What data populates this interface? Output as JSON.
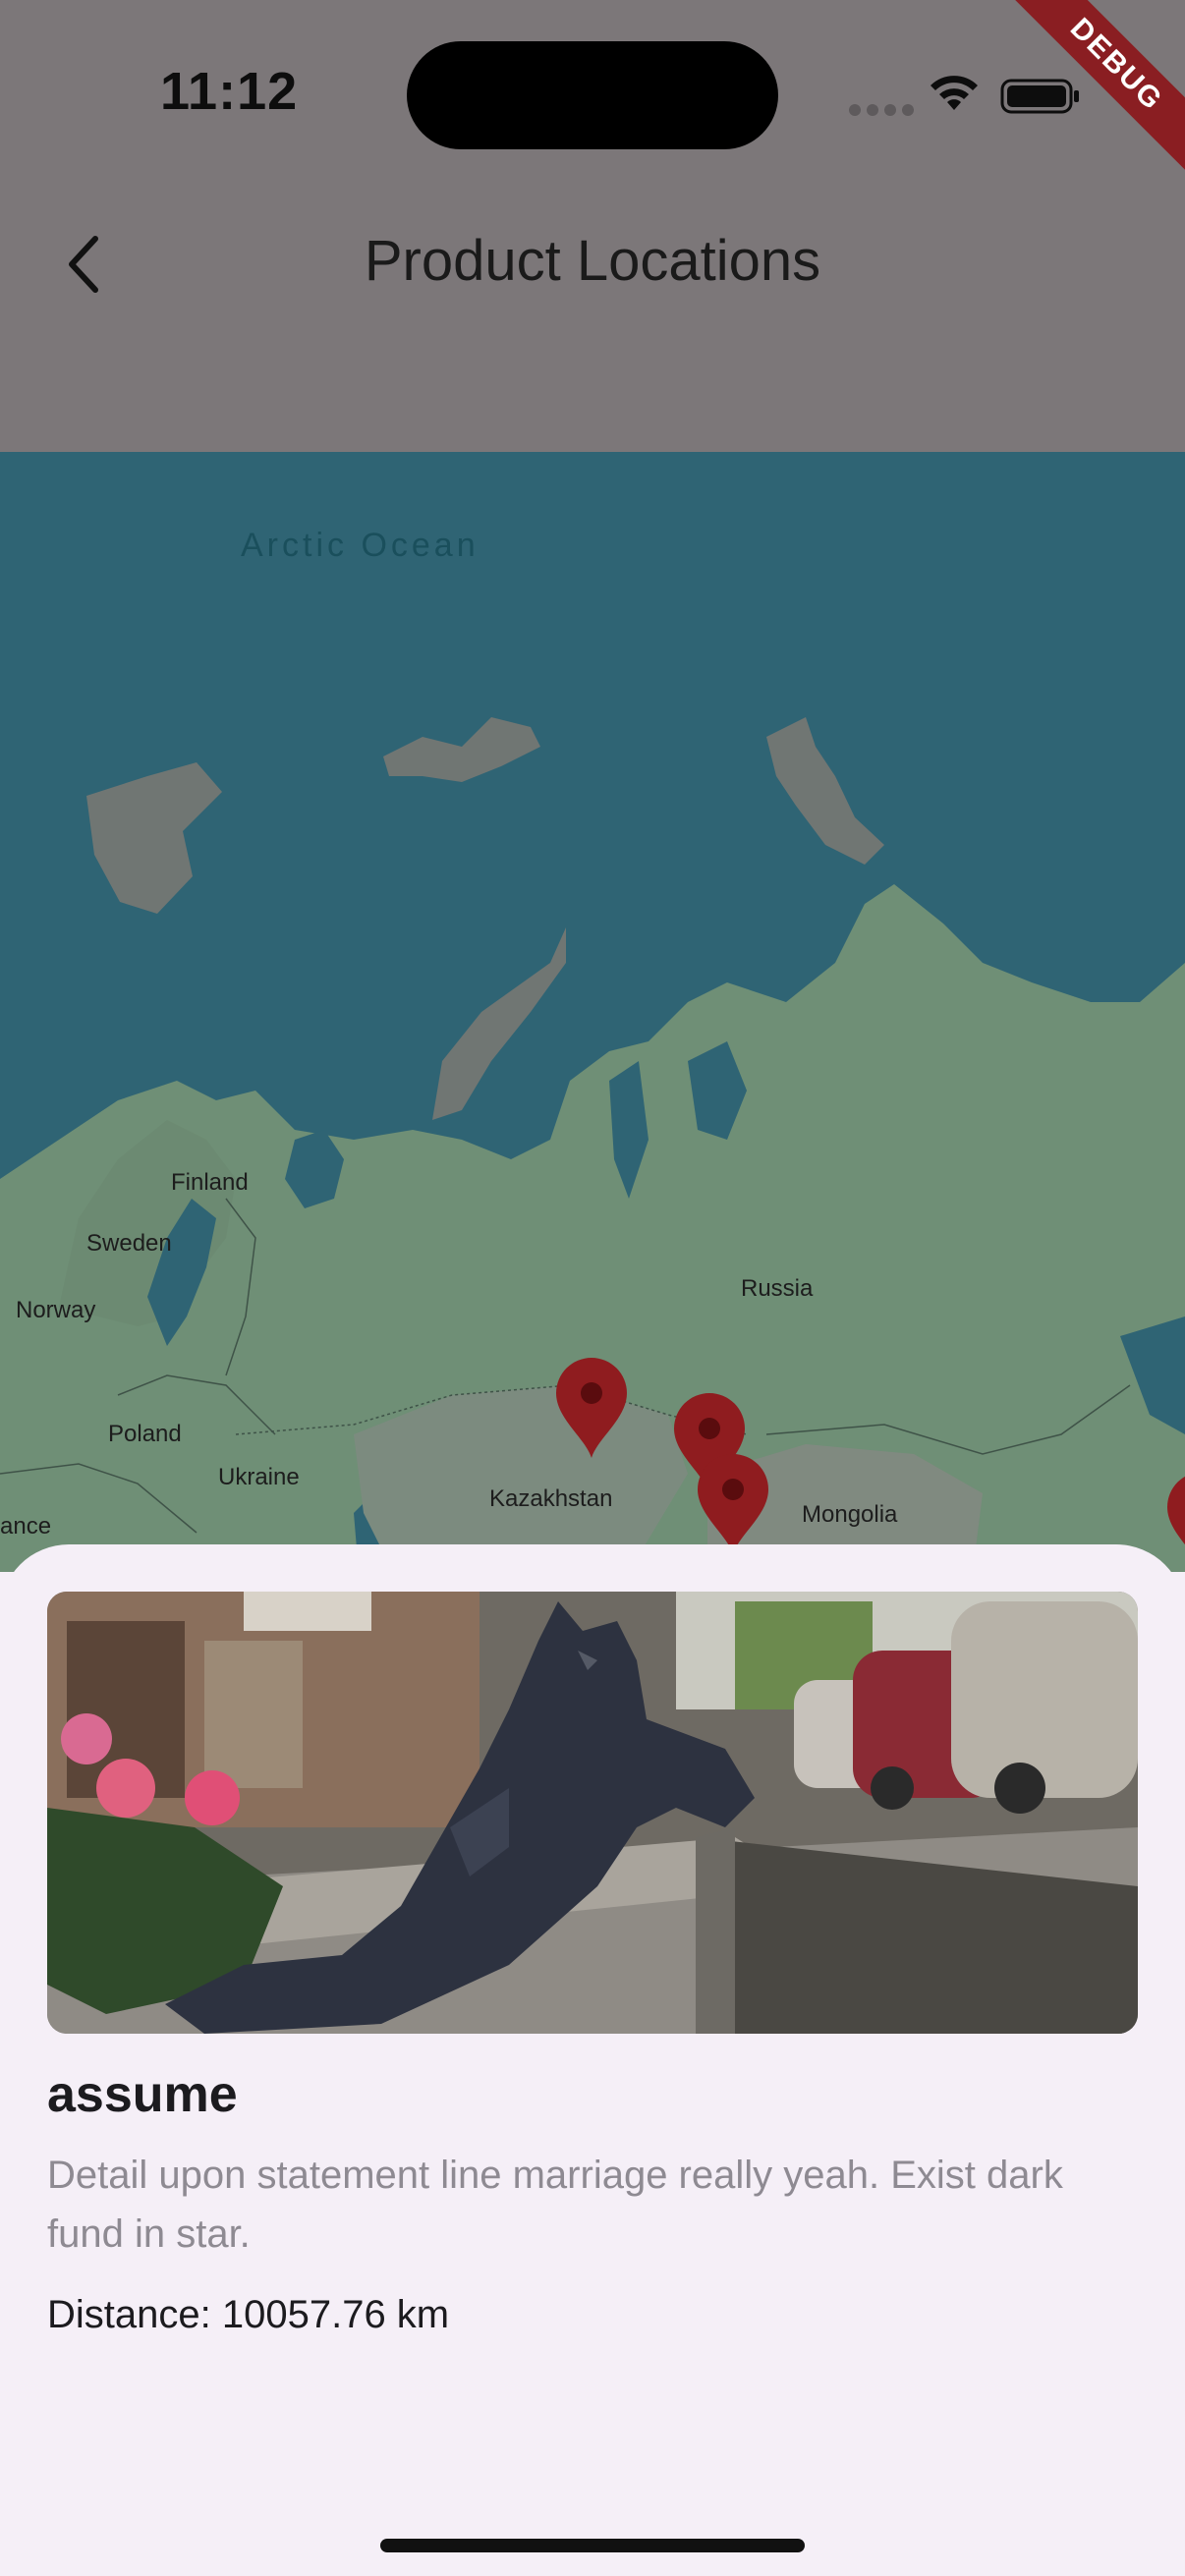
{
  "status_bar": {
    "time": "11:12",
    "debug_banner": "DEBUG"
  },
  "app_bar": {
    "title": "Product Locations",
    "back_icon": "chevron-left-icon"
  },
  "map": {
    "ocean_label": "Arctic Ocean",
    "place_labels": {
      "finland": "Finland",
      "sweden": "Sweden",
      "norway": "Norway",
      "russia": "Russia",
      "poland": "Poland",
      "ukraine": "Ukraine",
      "kazakhstan": "Kazakhstan",
      "mongolia": "Mongolia",
      "france_partial": "ance"
    },
    "marker_color": "#8f1c1f",
    "marker_count": 4
  },
  "product_card": {
    "title": "assume",
    "description": "Detail upon statement line marriage really yeah. Exist dark fund in star.",
    "distance": "Distance: 10057.76 km"
  },
  "colors": {
    "ocean": "#2f6474",
    "land": "#6f8f76",
    "appbar_scrim": "#7c7779",
    "sheet_bg": "#f5eff7",
    "debug": "#8a1e22"
  }
}
